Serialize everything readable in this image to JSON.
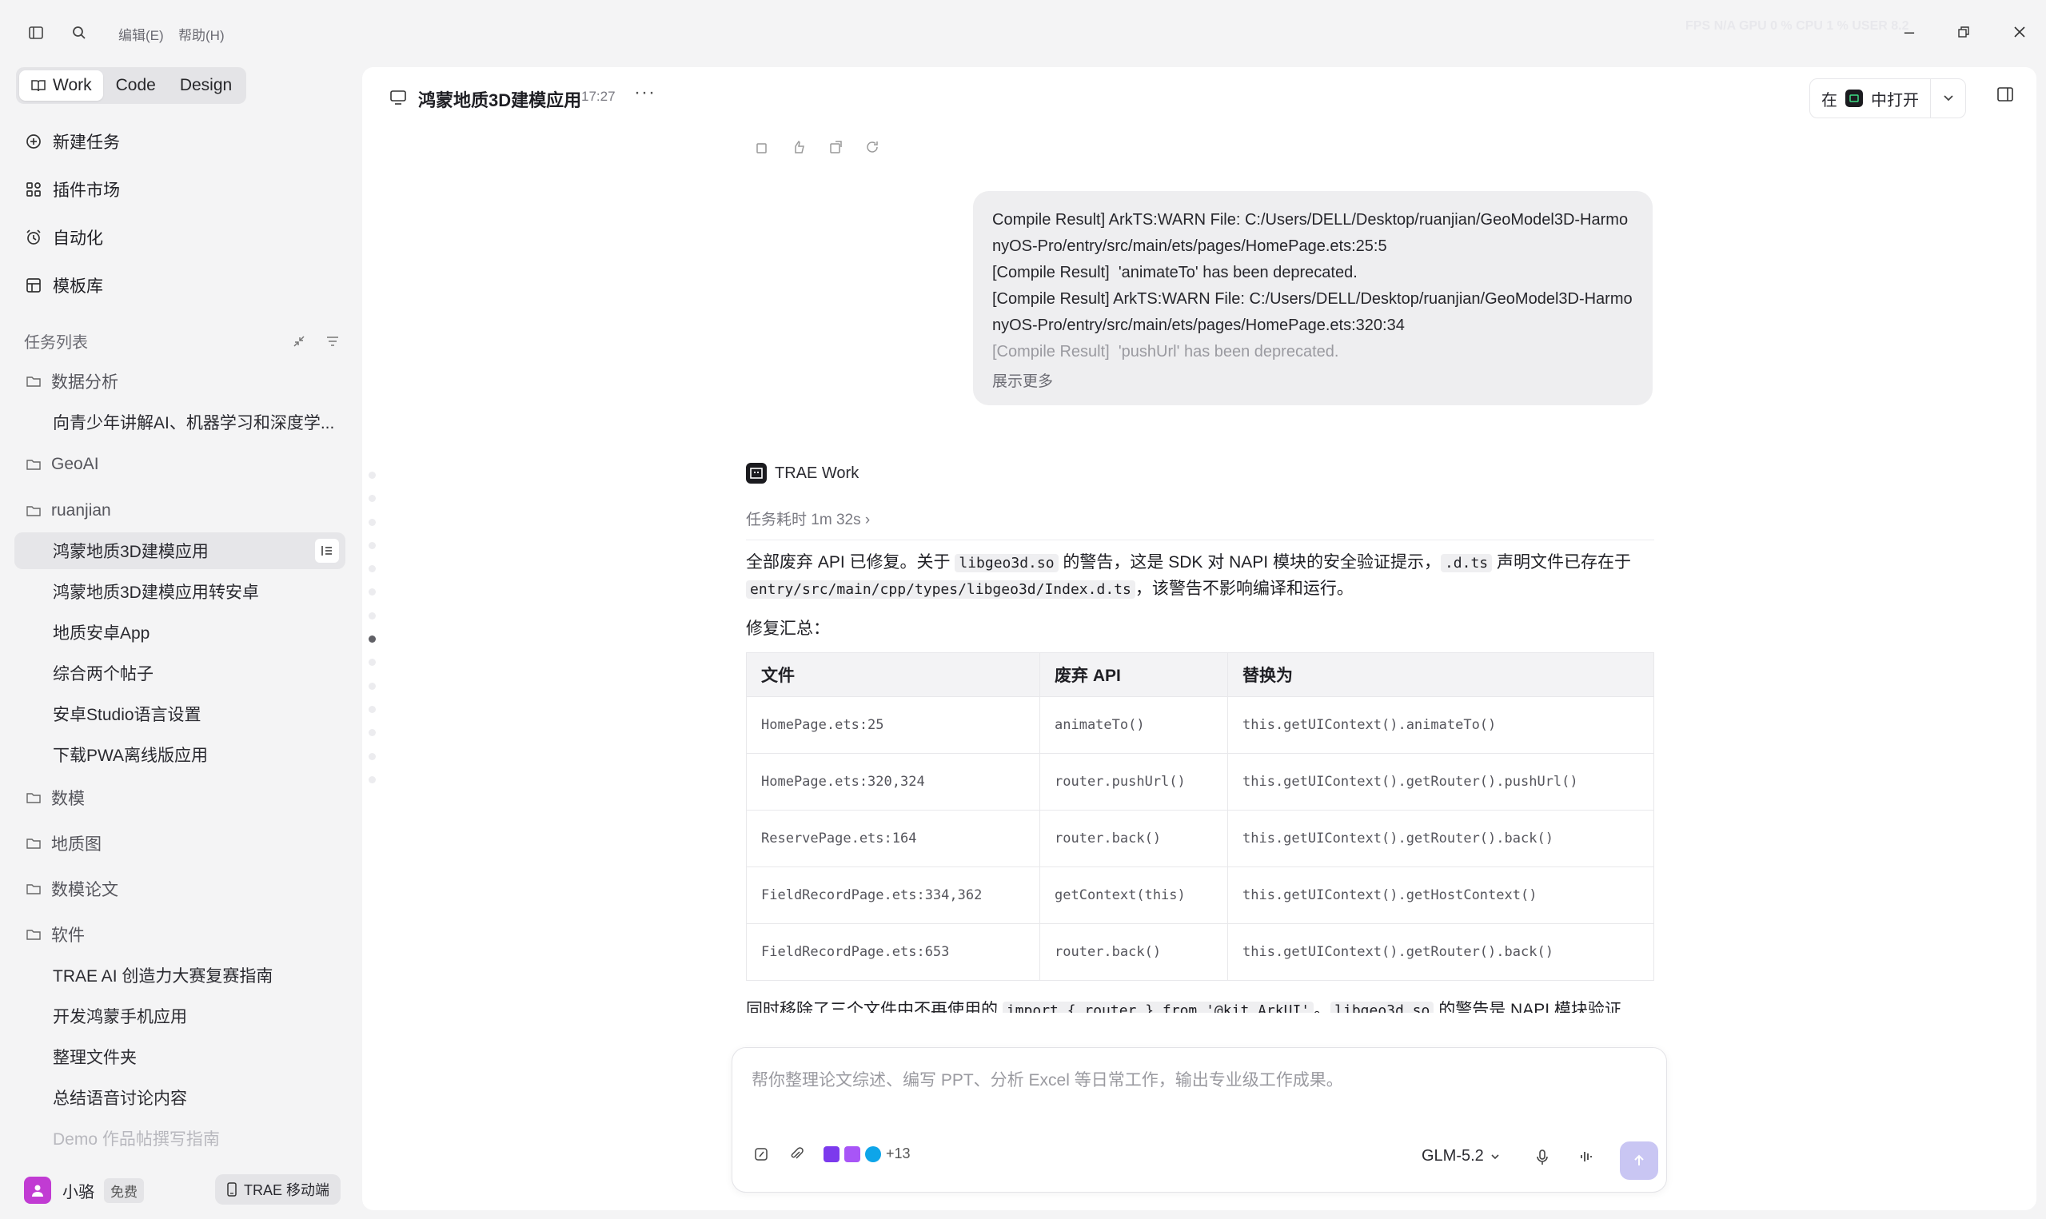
{
  "titlebar": {
    "menu_edit": "编辑(E)",
    "menu_help": "帮助(H)",
    "perf": "FPS N/A    GPU 0 %    CPU 1 %    USER 8.2"
  },
  "mode_tabs": [
    "Work",
    "Code",
    "Design"
  ],
  "nav": [
    "新建任务",
    "插件市场",
    "自动化",
    "模板库"
  ],
  "task_section": {
    "title": "任务列表"
  },
  "tasks": [
    {
      "type": "folder",
      "label": "数据分析"
    },
    {
      "type": "child",
      "label": "向青少年讲解AI、机器学习和深度学..."
    },
    {
      "type": "folder",
      "label": "GeoAI"
    },
    {
      "type": "folder",
      "label": "ruanjian"
    },
    {
      "type": "child",
      "label": "鸿蒙地质3D建模应用"
    },
    {
      "type": "child",
      "label": "鸿蒙地质3D建模应用转安卓"
    },
    {
      "type": "child",
      "label": "地质安卓App"
    },
    {
      "type": "child",
      "label": "综合两个帖子"
    },
    {
      "type": "child",
      "label": "安卓Studio语言设置"
    },
    {
      "type": "child",
      "label": "下载PWA离线版应用"
    },
    {
      "type": "folder",
      "label": "数模"
    },
    {
      "type": "folder",
      "label": "地质图"
    },
    {
      "type": "folder",
      "label": "数模论文"
    },
    {
      "type": "folder",
      "label": "软件"
    },
    {
      "type": "child",
      "label": "TRAE AI 创造力大赛复赛指南"
    },
    {
      "type": "child",
      "label": "开发鸿蒙手机应用"
    },
    {
      "type": "child",
      "label": "整理文件夹"
    },
    {
      "type": "child",
      "label": "总结语音讨论内容"
    },
    {
      "type": "child",
      "label": "Demo 作品帖撰写指南"
    }
  ],
  "user": {
    "name": "小骆",
    "plan": "免费",
    "mobile_button": "TRAE 移动端"
  },
  "header": {
    "title": "鸿蒙地质3D建模应用",
    "time": "17:27",
    "open_in_prefix": "在",
    "open_in_suffix": "中打开"
  },
  "user_message": {
    "lines": [
      "Compile Result] ArkTS:WARN File: C:/Users/DELL/Desktop/ruanjian/GeoModel3D-HarmonyOS-Pro/entry/src/main/ets/pages/HomePage.ets:25:5",
      "[Compile Result]  'animateTo' has been deprecated.",
      "[Compile Result] ArkTS:WARN File: C:/Users/DELL/Desktop/ruanjian/GeoModel3D-HarmonyOS-Pro/entry/src/main/ets/pages/HomePage.ets:320:34",
      "[Compile Result]  'pushUrl' has been deprecated."
    ],
    "show_more": "展示更多"
  },
  "reply": {
    "agent": "TRAE Work",
    "duration": "任务耗时 1m 32s",
    "p1_a": "全部废弃 API 已修复。关于 ",
    "p1_code1": "libgeo3d.so",
    "p1_b": " 的警告，这是 SDK 对 NAPI 模块的安全验证提示，",
    "p1_code2": ".d.ts",
    "p1_c": " 声明文件已存在于 ",
    "p1_code3": "entry/src/main/cpp/types/libgeo3d/Index.d.ts",
    "p1_d": "，该警告不影响编译和运行。",
    "summary_label": "修复汇总：",
    "table": {
      "headers": [
        "文件",
        "废弃 API",
        "替换为"
      ],
      "rows": [
        [
          "HomePage.ets:25",
          "animateTo()",
          "this.getUIContext().animateTo()"
        ],
        [
          "HomePage.ets:320,324",
          "router.pushUrl()",
          "this.getUIContext().getRouter().pushUrl()"
        ],
        [
          "ReservePage.ets:164",
          "router.back()",
          "this.getUIContext().getRouter().back()"
        ],
        [
          "FieldRecordPage.ets:334,362",
          "getContext(this)",
          "this.getUIContext().getHostContext()"
        ],
        [
          "FieldRecordPage.ets:653",
          "router.back()",
          "this.getUIContext().getRouter().back()"
        ]
      ]
    },
    "trailing_a": "同时移除了三个文件中不再使用的 ",
    "trailing_code1": "import { router } from '@kit.ArkUI'",
    "trailing_b": "。",
    "trailing_code2": "libgeo3d.so",
    "trailing_c": " 的警告是 NAPI 模块验证"
  },
  "composer": {
    "placeholder": "帮你整理论文综述、编写 PPT、分析 Excel 等日常工作，输出专业级工作成果。",
    "more_count": "+13",
    "model": "GLM-5.2"
  },
  "colors": {
    "accent": "#c9c6f3",
    "avatar": "#c13bd3"
  }
}
